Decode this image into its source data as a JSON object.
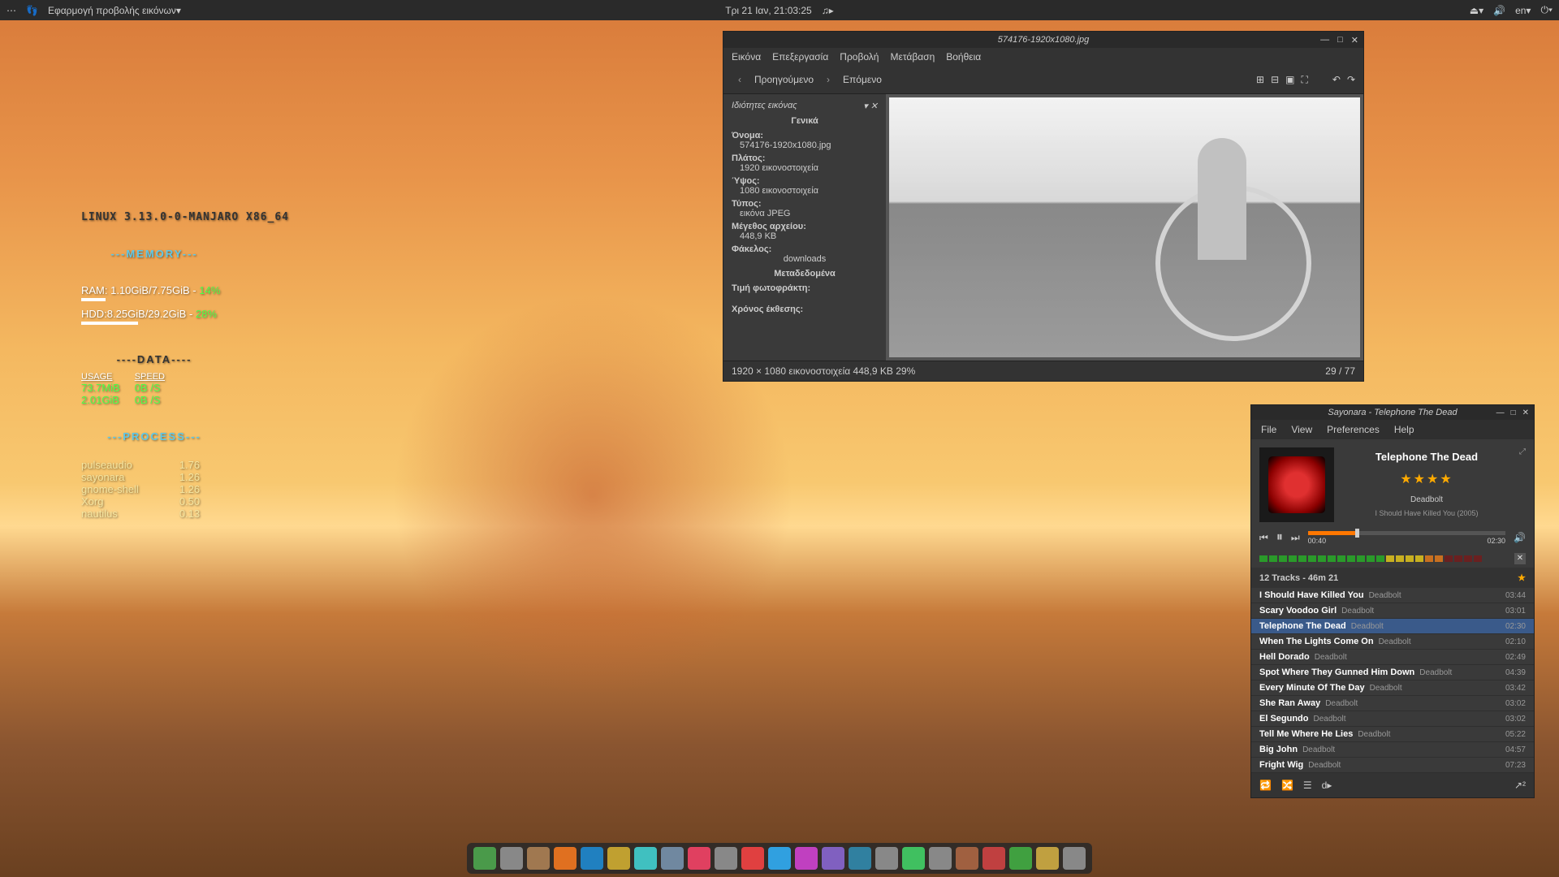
{
  "topbar": {
    "app_label": "Εφαρμογή προβολής εικόνων▾",
    "datetime": "Τρι 21 Ιαν, 21:03:25",
    "lang": "en▾"
  },
  "conky": {
    "os": "LINUX 3.13.0-0-MANJARO X86_64",
    "mem_header": "---MEMORY---",
    "ram_line": "RAM: 1.10GiB/7.75GiB",
    "ram_pct": "14%",
    "hdd_line": "HDD:8.25GiB/29.2GiB",
    "hdd_pct": "28%",
    "data_header": "----DATA----",
    "usage_lbl": "USAGE",
    "speed_lbl": "SPEED",
    "rows": [
      {
        "usage": "73.7MiB",
        "speed": "0B /S"
      },
      {
        "usage": "2.01GiB",
        "speed": "0B /S"
      }
    ],
    "proc_header": "---PROCESS---",
    "procs": [
      {
        "name": "pulseaudio",
        "val": "1.76"
      },
      {
        "name": "sayonara",
        "val": "1.26"
      },
      {
        "name": "gnome-shell",
        "val": "1.26"
      },
      {
        "name": "Xorg",
        "val": "0.50"
      },
      {
        "name": "nautilus",
        "val": "0.13"
      }
    ]
  },
  "imgwin": {
    "title": "574176-1920x1080.jpg",
    "menu": [
      "Εικόνα",
      "Επεξεργασία",
      "Προβολή",
      "Μετάβαση",
      "Βοήθεια"
    ],
    "prev": "Προηγούμενο",
    "next": "Επόμενο",
    "props_title": "Ιδιότητες εικόνας",
    "general": "Γενικά",
    "name_lbl": "Όνομα:",
    "name_val": "574176-1920x1080.jpg",
    "width_lbl": "Πλάτος:",
    "width_val": "1920 εικονοστοιχεία",
    "height_lbl": "Ύψος:",
    "height_val": "1080 εικονοστοιχεία",
    "type_lbl": "Τύπος:",
    "type_val": "εικόνα JPEG",
    "size_lbl": "Μέγεθος αρχείου:",
    "size_val": "448,9 KB",
    "folder_lbl": "Φάκελος:",
    "folder_val": "downloads",
    "meta": "Μεταδεδομένα",
    "aperture_lbl": "Τιμή φωτοφράκτη:",
    "exposure_lbl": "Χρόνος έκθεσης:",
    "status_left": "1920 × 1080 εικονοστοιχεία  448,9 KB    29%",
    "status_right": "29 / 77"
  },
  "player": {
    "title": "Sayonara - Telephone The Dead",
    "menu": [
      "File",
      "View",
      "Preferences",
      "Help"
    ],
    "np_title": "Telephone The Dead",
    "np_artist": "Deadbolt",
    "np_album": "I Should Have Killed You (2005)",
    "stars": "★★★★",
    "t_elapsed": "00:40",
    "t_total": "02:30",
    "playlist_header": "12 Tracks - 46m 21",
    "tracks": [
      {
        "name": "I Should Have Killed You",
        "artist": "Deadbolt",
        "dur": "03:44"
      },
      {
        "name": "Scary Voodoo Girl",
        "artist": "Deadbolt",
        "dur": "03:01"
      },
      {
        "name": "Telephone The Dead",
        "artist": "Deadbolt",
        "dur": "02:30"
      },
      {
        "name": "When The Lights Come On",
        "artist": "Deadbolt",
        "dur": "02:10"
      },
      {
        "name": "Hell Dorado",
        "artist": "Deadbolt",
        "dur": "02:49"
      },
      {
        "name": "Spot Where They Gunned Him Down",
        "artist": "Deadbolt",
        "dur": "04:39"
      },
      {
        "name": "Every Minute Of The Day",
        "artist": "Deadbolt",
        "dur": "03:42"
      },
      {
        "name": "She Ran Away",
        "artist": "Deadbolt",
        "dur": "03:02"
      },
      {
        "name": "El Segundo",
        "artist": "Deadbolt",
        "dur": "03:02"
      },
      {
        "name": "Tell Me Where He Lies",
        "artist": "Deadbolt",
        "dur": "05:22"
      },
      {
        "name": "Big John",
        "artist": "Deadbolt",
        "dur": "04:57"
      },
      {
        "name": "Fright Wig",
        "artist": "Deadbolt",
        "dur": "07:23"
      }
    ],
    "active_index": 2
  },
  "dock": {
    "colors": [
      "#4a9a4a",
      "#888",
      "#a07850",
      "#e07020",
      "#2080c0",
      "#c0a030",
      "#40c0c0",
      "#7088a0",
      "#e04060",
      "#888",
      "#e04040",
      "#30a0e0",
      "#c040c0",
      "#8060c0",
      "#3080a0",
      "#888",
      "#40c060",
      "#888",
      "#a06040",
      "#c04040",
      "#40a040",
      "#c0a040",
      "#888"
    ]
  }
}
